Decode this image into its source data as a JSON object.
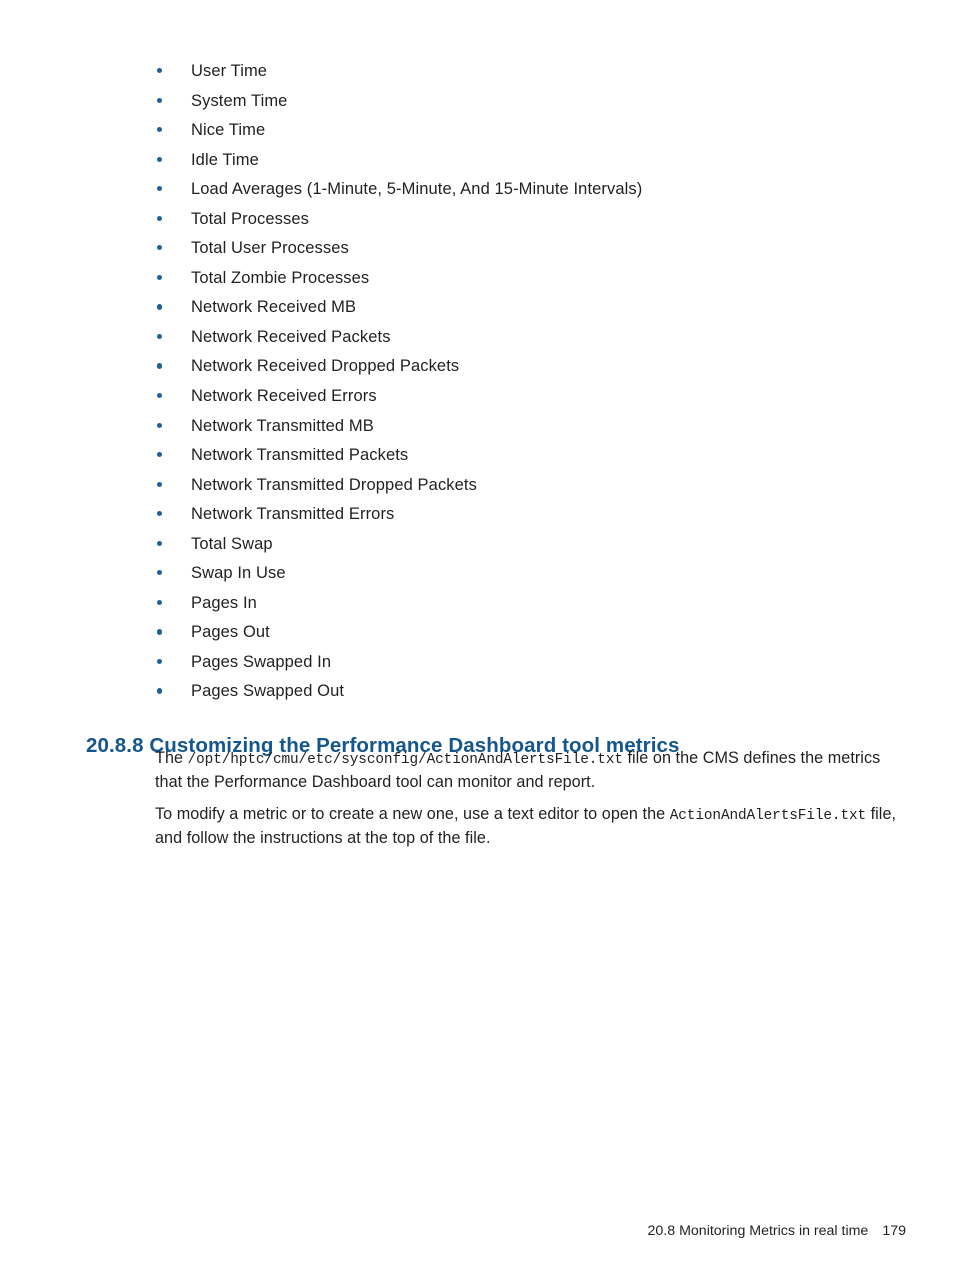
{
  "document": {
    "metrics_list": [
      "User Time",
      "System Time",
      "Nice Time",
      "Idle Time",
      "Load Averages (1-Minute, 5-Minute, And 15-Minute Intervals)",
      "Total Processes",
      "Total User Processes",
      "Total Zombie Processes",
      "Network Received MB",
      "Network Received Packets",
      "Network Received Dropped Packets",
      "Network Received Errors",
      "Network Transmitted MB",
      "Network Transmitted Packets",
      "Network Transmitted Dropped Packets",
      "Network Transmitted Errors",
      "Total Swap",
      "Swap In Use",
      "Pages In",
      "Pages Out",
      "Pages Swapped In",
      "Pages Swapped Out"
    ],
    "section": {
      "number": "20.8.8",
      "title": "Customizing the Performance Dashboard tool metrics",
      "heading_full": "20.8.8 Customizing the Performance Dashboard tool metrics",
      "heading_color": "#15568e"
    },
    "paragraphs": {
      "first": {
        "lead": "The ",
        "path": "/opt/hptc/cmu/etc/sysconfig/ActionAndAlertsFile.txt",
        "tail": " file on the CMS defines the metrics that the Performance Dashboard tool can monitor and report."
      },
      "second": {
        "lead": "To modify a metric or to create a new one, use a text editor to open the ",
        "filename": "ActionAndAlertsFile.txt",
        "tail": " file, and follow the instructions at the top of the file."
      }
    },
    "footer": {
      "running_head": "20.8 Monitoring Metrics in real time",
      "page_number": "179"
    },
    "colors": {
      "bullet": "#1f5f9e",
      "heading": "#15568e",
      "body_text": "#231f20",
      "background": "#ffffff"
    }
  }
}
